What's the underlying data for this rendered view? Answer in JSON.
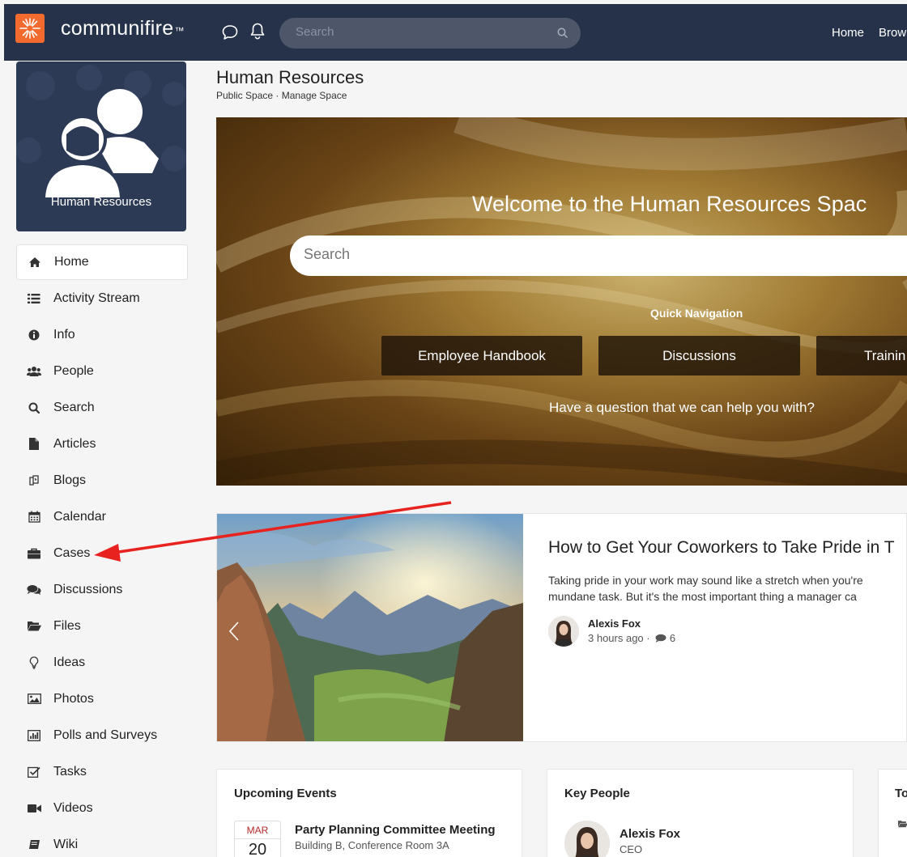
{
  "topbar": {
    "brand": "communifire",
    "brand_mark": "™",
    "search_placeholder": "Search",
    "links": [
      "Home",
      "Brow"
    ]
  },
  "space": {
    "tile_label": "Human Resources",
    "title": "Human Resources",
    "subtitle": "Public Space · Manage Space"
  },
  "sidebar": {
    "items": [
      {
        "label": "Home",
        "icon": "home-icon",
        "active": true
      },
      {
        "label": "Activity Stream",
        "icon": "list-icon"
      },
      {
        "label": "Info",
        "icon": "info-icon"
      },
      {
        "label": "People",
        "icon": "people-icon"
      },
      {
        "label": "Search",
        "icon": "search-icon"
      },
      {
        "label": "Articles",
        "icon": "document-icon"
      },
      {
        "label": "Blogs",
        "icon": "blog-icon"
      },
      {
        "label": "Calendar",
        "icon": "calendar-icon"
      },
      {
        "label": "Cases",
        "icon": "briefcase-icon"
      },
      {
        "label": "Discussions",
        "icon": "comments-icon"
      },
      {
        "label": "Files",
        "icon": "folder-icon"
      },
      {
        "label": "Ideas",
        "icon": "lightbulb-icon"
      },
      {
        "label": "Photos",
        "icon": "photo-icon"
      },
      {
        "label": "Polls and Surveys",
        "icon": "bar-chart-icon"
      },
      {
        "label": "Tasks",
        "icon": "checkbox-icon"
      },
      {
        "label": "Videos",
        "icon": "video-camera-icon"
      },
      {
        "label": "Wiki",
        "icon": "book-icon"
      }
    ]
  },
  "hero": {
    "title": "Welcome to the Human Resources Spac",
    "search_placeholder": "Search",
    "quick_nav_label": "Quick Navigation",
    "buttons": [
      "Employee Handbook",
      "Discussions",
      "Trainin"
    ],
    "question": "Have a question that we can help you with?"
  },
  "feature": {
    "title": "How to Get Your Coworkers to Take Pride in T",
    "desc_line1": "Taking pride in your work may sound like a stretch when you're",
    "desc_line2": "mundane task. But it's the most important thing a manager ca",
    "author": "Alexis Fox",
    "time": "3 hours ago",
    "comments": "6"
  },
  "events": {
    "title": "Upcoming Events",
    "month": "MAR",
    "day": "20",
    "event_title": "Party Planning Committee Meeting",
    "location": "Building B, Conference Room 3A"
  },
  "key_people": {
    "title": "Key People",
    "name": "Alexis Fox",
    "role": "CEO"
  },
  "third_card": {
    "title_fragment": "To"
  },
  "colors": {
    "topbar": "#253249",
    "brand_accent": "#f26a2e",
    "annotation_arrow": "#e8231f"
  }
}
